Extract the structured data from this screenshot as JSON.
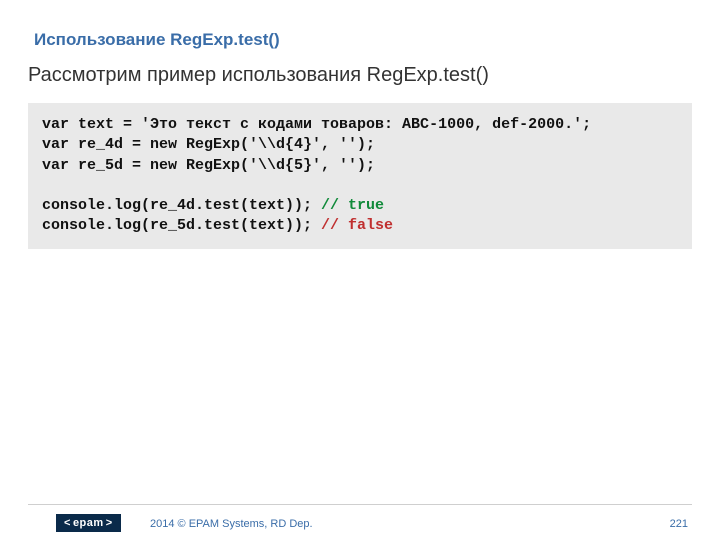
{
  "heading": "Использование RegExp.test()",
  "subheading": "Рассмотрим пример использования RegExp.test()",
  "code": {
    "line1": "var text = 'Это текст с кодами товаров: ABC-1000, def-2000.';",
    "line2": "var re_4d = new RegExp('\\\\d{4}', '');",
    "line3": "var re_5d = new RegExp('\\\\d{5}', '');",
    "line4": "",
    "line5a": "console.log(re_4d.test(text)); ",
    "line5b": "// true",
    "line6a": "console.log(re_5d.test(text)); ",
    "line6b": "// false"
  },
  "footer": {
    "logo_text": "epam",
    "copyright": "2014 © EPAM Systems, RD Dep.",
    "page_number": "221"
  }
}
